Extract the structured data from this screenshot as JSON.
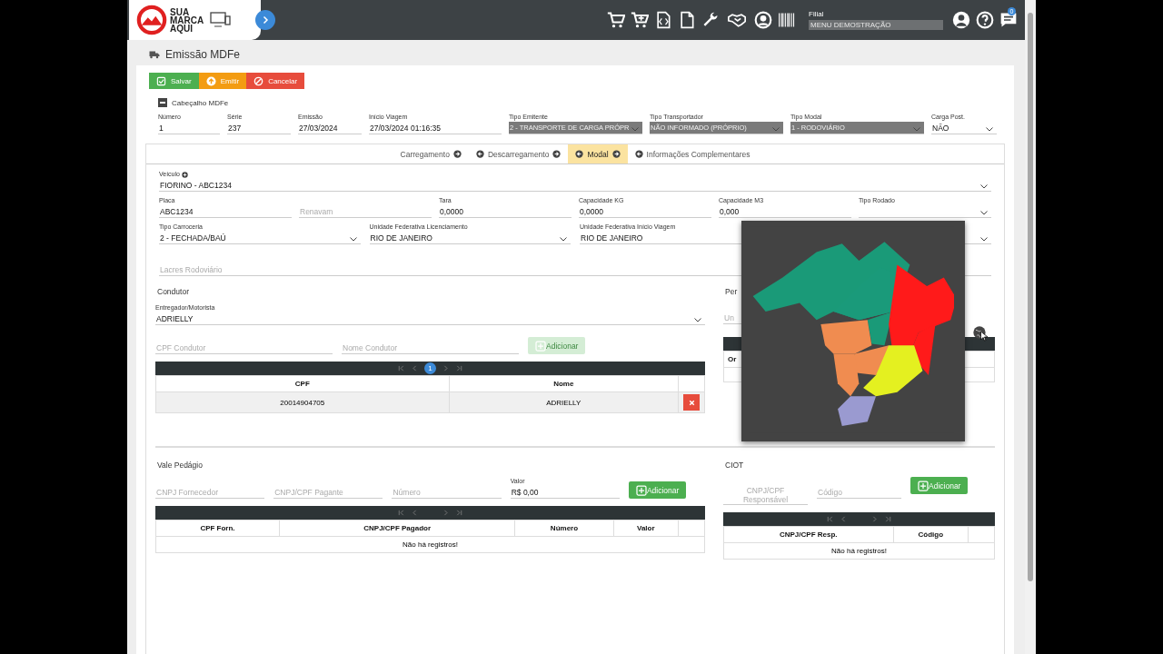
{
  "header": {
    "logo_lines": [
      "SUA",
      "MARCA",
      "AQUI"
    ],
    "filial_label": "Filial",
    "filial_value": "MENU DEMOSTRAÇÃO",
    "notification_count": "0"
  },
  "page_title": "Emissão MDFe",
  "actions": [
    {
      "label": "Salvar",
      "kind": "save"
    },
    {
      "label": "Emitir",
      "kind": "emit"
    },
    {
      "label": "Cancelar",
      "kind": "cancel"
    }
  ],
  "header_section": {
    "title": "Cabeçalho MDFe",
    "expanded": true,
    "fields": [
      {
        "label": "Número",
        "value": "1",
        "kind": "input",
        "disabled": false
      },
      {
        "label": "Série",
        "value": "237",
        "kind": "input",
        "disabled": false
      },
      {
        "label": "Emissão",
        "value": "27/03/2024",
        "kind": "input",
        "disabled": false
      },
      {
        "label": "Início Viagem",
        "value": "27/03/2024 01:16:35",
        "kind": "input",
        "disabled": false
      },
      {
        "label": "Tipo Emitente",
        "value": "2 - TRANSPORTE DE CARGA PRÓPR",
        "kind": "select",
        "disabled": true
      },
      {
        "label": "Tipo Transportador",
        "value": "NÃO INFORMADO (PRÓPRIO)",
        "kind": "select",
        "disabled": true
      },
      {
        "label": "Tipo Modal",
        "value": "1 - RODOVIÁRIO",
        "kind": "select",
        "disabled": true
      },
      {
        "label": "Carga Post.",
        "value": "NÃO",
        "kind": "select",
        "disabled": false
      }
    ]
  },
  "tabs": [
    {
      "label": "Carregamento",
      "selected": false,
      "arrow_before": false,
      "arrow_after": true
    },
    {
      "label": "Descarregamento",
      "selected": false,
      "arrow_before": true,
      "arrow_after": true
    },
    {
      "label": "Modal",
      "selected": true,
      "arrow_before": true,
      "arrow_after": true
    },
    {
      "label": "Informações Complementares",
      "selected": false,
      "arrow_before": true,
      "arrow_after": false
    }
  ],
  "modal": {
    "vehicle": {
      "label": "Veículo",
      "value": "FIORINO - ABC1234",
      "kind": "select"
    },
    "measures": [
      {
        "label": "Placa",
        "value": "ABC1234",
        "kind": "input"
      },
      {
        "placeholder": "Renavam",
        "kind": "input"
      },
      {
        "label": "Tara",
        "value": "0,0000",
        "kind": "input"
      },
      {
        "label": "Capacidade KG",
        "value": "0,0000",
        "kind": "input"
      },
      {
        "label": "Capacidade M3",
        "value": "0,000",
        "kind": "input"
      },
      {
        "label": "Tipo Rodado",
        "kind": "select"
      }
    ],
    "locations": [
      {
        "label": "Tipo Carroceria",
        "value": "2 - FECHADA/BAÚ",
        "kind": "select"
      },
      {
        "label": "Unidade Federativa Licenciamento",
        "value": "RIO DE JANEIRO",
        "kind": "select"
      },
      {
        "label": "Unidade Federativa Início Viagem",
        "value": "RIO DE JANEIRO",
        "kind": "input"
      },
      {
        "kind": "select"
      }
    ],
    "seals": {
      "placeholder": "Lacres Rodoviário",
      "kind": "input"
    }
  },
  "driver_section": {
    "title": "Condutor",
    "driver": {
      "label": "Entregador/Motorista",
      "value": "ADRIELLY",
      "kind": "select"
    },
    "inputs": [
      {
        "placeholder": "CPF Condutor",
        "kind": "input"
      },
      {
        "placeholder": "Nome Condutor",
        "kind": "input"
      }
    ],
    "add_button": {
      "label": "Adicionar",
      "disabled": true
    },
    "pager": {
      "page": "1"
    },
    "columns": [
      "CPF",
      "Nome"
    ],
    "rows": [
      {
        "cells": [
          "20014904705",
          "ADRIELLY"
        ]
      }
    ]
  },
  "route_section": {
    "title": "Per",
    "placeholder": "Un",
    "columns": [
      "Or"
    ]
  },
  "toll_section": {
    "title": "Vale Pedágio",
    "inputs": [
      {
        "placeholder": "CNPJ Fornecedor",
        "kind": "input"
      },
      {
        "placeholder": "CNPJ/CPF Pagante",
        "kind": "input"
      },
      {
        "placeholder": "Número",
        "kind": "input"
      },
      {
        "label": "Valor",
        "value": "R$ 0,00",
        "kind": "input"
      }
    ],
    "add_button": {
      "label": "Adicionar",
      "disabled": false
    },
    "columns": [
      "CPF Forn.",
      "CNPJ/CPF Pagador",
      "Número",
      "Valor"
    ],
    "empty": "Não há registros!"
  },
  "ciot_section": {
    "title": "CIOT",
    "inputs": [
      {
        "placeholder": "CNPJ/CPF Responsável",
        "kind": "input"
      },
      {
        "placeholder": "Código",
        "kind": "input"
      }
    ],
    "add_button": {
      "label": "Adicionar",
      "disabled": false
    },
    "columns": [
      "CNPJ/CPF Resp.",
      "Código"
    ],
    "empty": "Não há registros!"
  }
}
